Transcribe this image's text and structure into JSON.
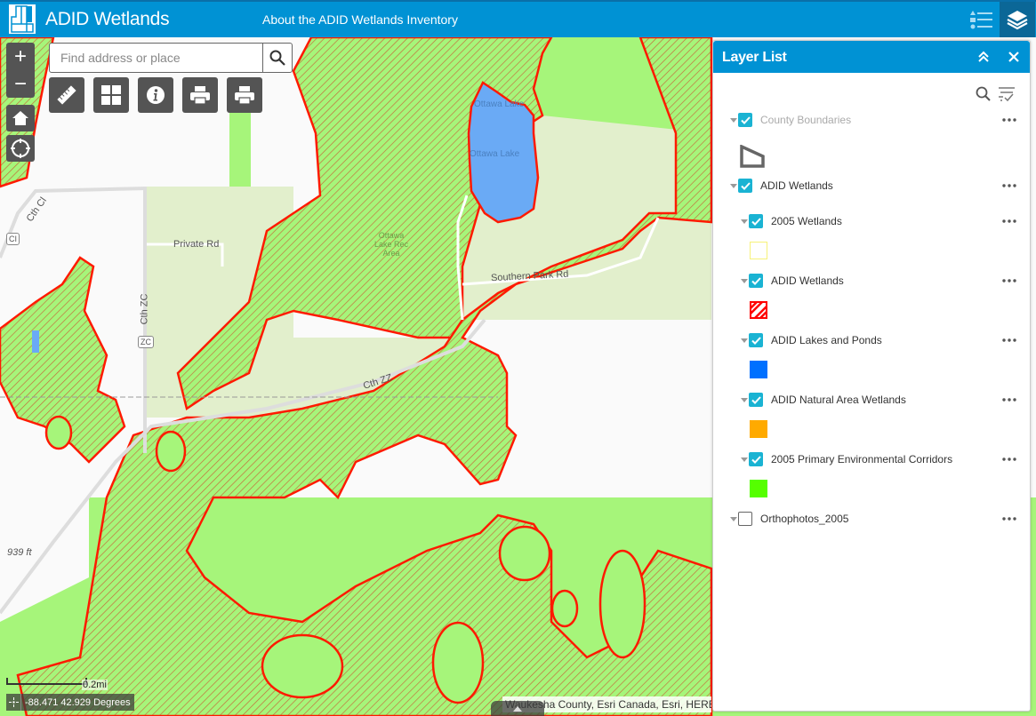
{
  "header": {
    "app_title": "ADID Wetlands",
    "about_link": "About the ADID Wetlands Inventory",
    "legend_button_icon": "legend-list-icon",
    "layers_button_icon": "layers-stack-icon"
  },
  "map": {
    "search": {
      "placeholder": "Find address or place",
      "value": ""
    },
    "zoom_in": "+",
    "zoom_out": "−",
    "tools": [
      {
        "name": "measure",
        "icon": "ruler-icon"
      },
      {
        "name": "basemap-gallery",
        "icon": "grid-icon"
      },
      {
        "name": "about",
        "icon": "info-icon"
      },
      {
        "name": "print",
        "icon": "printer-icon"
      },
      {
        "name": "print-2",
        "icon": "printer-icon"
      }
    ],
    "labels": {
      "ottawa_lake_1": "Ottawa Lake",
      "ottawa_lake_2": "Ottawa Lake",
      "ottawa_rec_area": "Ottawa Lake Rec Area",
      "southern_park_rd": "Southern Park Rd",
      "private_rd": "Private Rd",
      "cth_cl": "Cth Cl",
      "cth_zc": "Cth ZC",
      "cth_zz": "Cth ZZ",
      "shield_cl": "CI",
      "shield_zc": "ZC",
      "elevation": "939 ft"
    },
    "scale_label": "0.2mi",
    "coordinates": "-88.471 42.929 Degrees",
    "attribution": "Waukesha County, Esri Canada, Esri, HERE"
  },
  "layer_list": {
    "title": "Layer List",
    "layers": [
      {
        "name": "County Boundaries",
        "checked": true,
        "level": 0,
        "dim": true,
        "legend": "polygon-outline"
      },
      {
        "name": "ADID Wetlands",
        "checked": true,
        "level": 0,
        "dim": false,
        "legend": null
      },
      {
        "name": "2005 Wetlands",
        "checked": true,
        "level": 1,
        "dim": false,
        "legend": "#ffffc8"
      },
      {
        "name": "ADID Wetlands",
        "checked": true,
        "level": 1,
        "dim": false,
        "legend": "hatch-red"
      },
      {
        "name": "ADID Lakes and Ponds",
        "checked": true,
        "level": 1,
        "dim": false,
        "legend": "#0070ff"
      },
      {
        "name": "ADID Natural Area Wetlands",
        "checked": true,
        "level": 1,
        "dim": false,
        "legend": "#ffaa00"
      },
      {
        "name": "2005 Primary Environmental Corridors",
        "checked": true,
        "level": 1,
        "dim": false,
        "legend": "#55ff00"
      },
      {
        "name": "Orthophotos_2005",
        "checked": false,
        "level": 0,
        "dim": false,
        "legend": null
      }
    ]
  },
  "colors": {
    "brand": "#0092d4",
    "checkbox": "#1ab3d3",
    "wetland_outline": "#ff1a00",
    "corridor_green": "#a6f57a",
    "lake_blue": "#6aaaf5"
  }
}
